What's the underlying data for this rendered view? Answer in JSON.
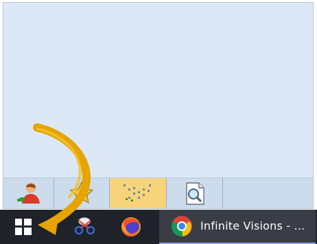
{
  "taskbar": {
    "chrome_title": "Infinite Visions - ...",
    "background_color": "#1f2229",
    "chrome_button_color": "#3a3d45"
  },
  "toolbar": {
    "buttons": [
      {
        "icon": "user-icon"
      },
      {
        "icon": "star-icon"
      },
      {
        "icon": "dots-arrow-icon"
      },
      {
        "icon": "magnifier-document-icon"
      }
    ],
    "active_button_color": "#f7d47b"
  },
  "overlay": {
    "arrow_color": "#e5a400"
  }
}
